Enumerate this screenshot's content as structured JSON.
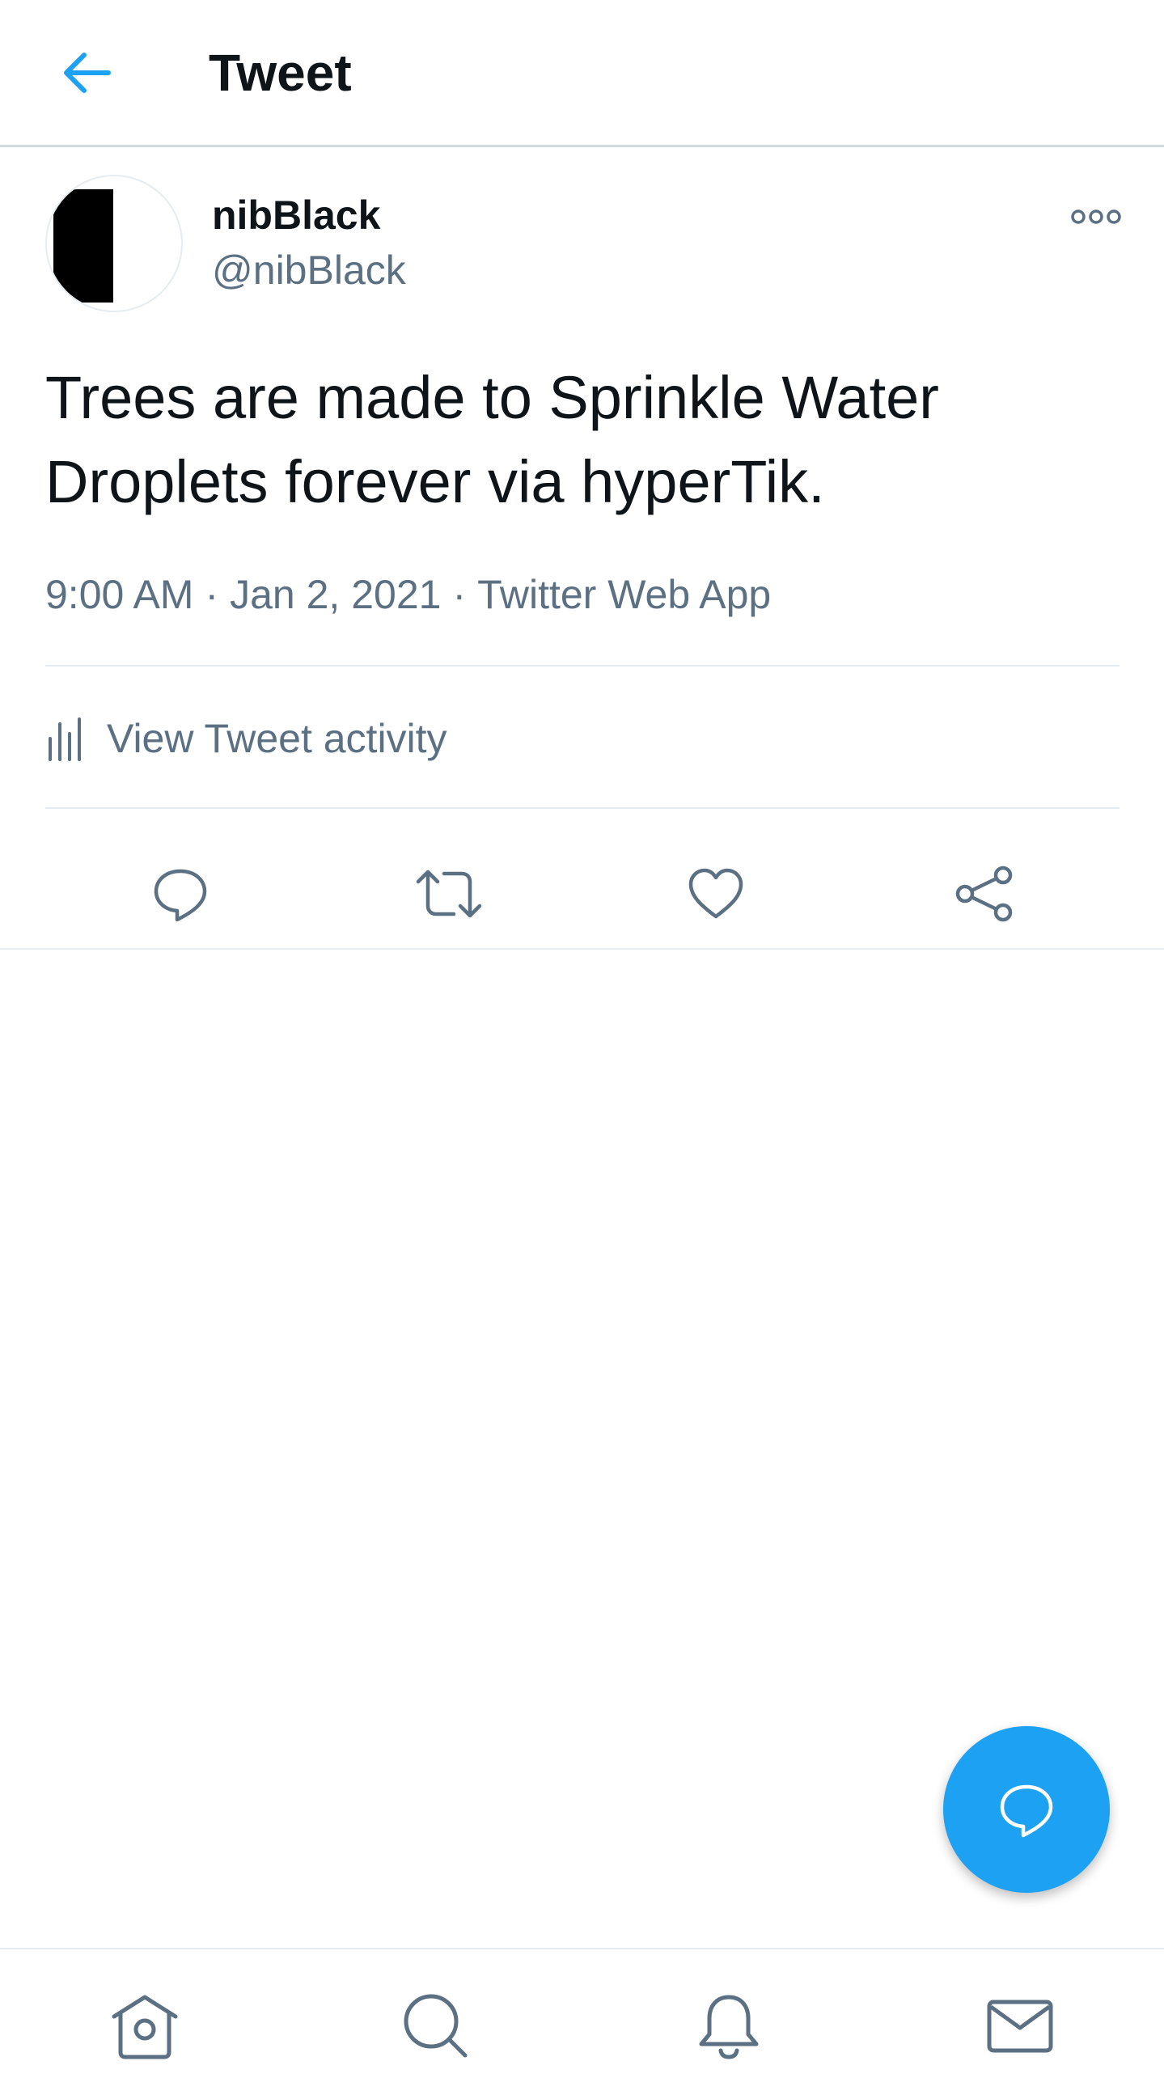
{
  "header": {
    "title": "Tweet",
    "back_icon": "arrow-left-icon"
  },
  "tweet": {
    "display_name": "nibBlack",
    "handle": "@nibBlack",
    "text": "Trees are made to Sprinkle Water Droplets forever via hyperTik.",
    "time": "9:00 AM",
    "date": "Jan 2, 2021",
    "source": "Twitter Web App",
    "meta_separator": "·",
    "more_icon": "more-icon"
  },
  "activity": {
    "label": "View Tweet activity",
    "icon": "bar-chart-icon"
  },
  "actions": [
    {
      "name": "reply",
      "icon": "reply-icon"
    },
    {
      "name": "retweet",
      "icon": "retweet-icon"
    },
    {
      "name": "like",
      "icon": "heart-icon"
    },
    {
      "name": "share",
      "icon": "share-icon"
    }
  ],
  "fab": {
    "icon": "compose-reply-icon"
  },
  "bottom_nav": [
    {
      "name": "home",
      "icon": "home-icon"
    },
    {
      "name": "search",
      "icon": "search-icon"
    },
    {
      "name": "notifications",
      "icon": "bell-icon"
    },
    {
      "name": "messages",
      "icon": "mail-icon"
    }
  ],
  "colors": {
    "accent": "#1da1f2",
    "secondary_text": "#5b7083",
    "primary_text": "#0f1419",
    "divider": "#e6ecf0"
  }
}
